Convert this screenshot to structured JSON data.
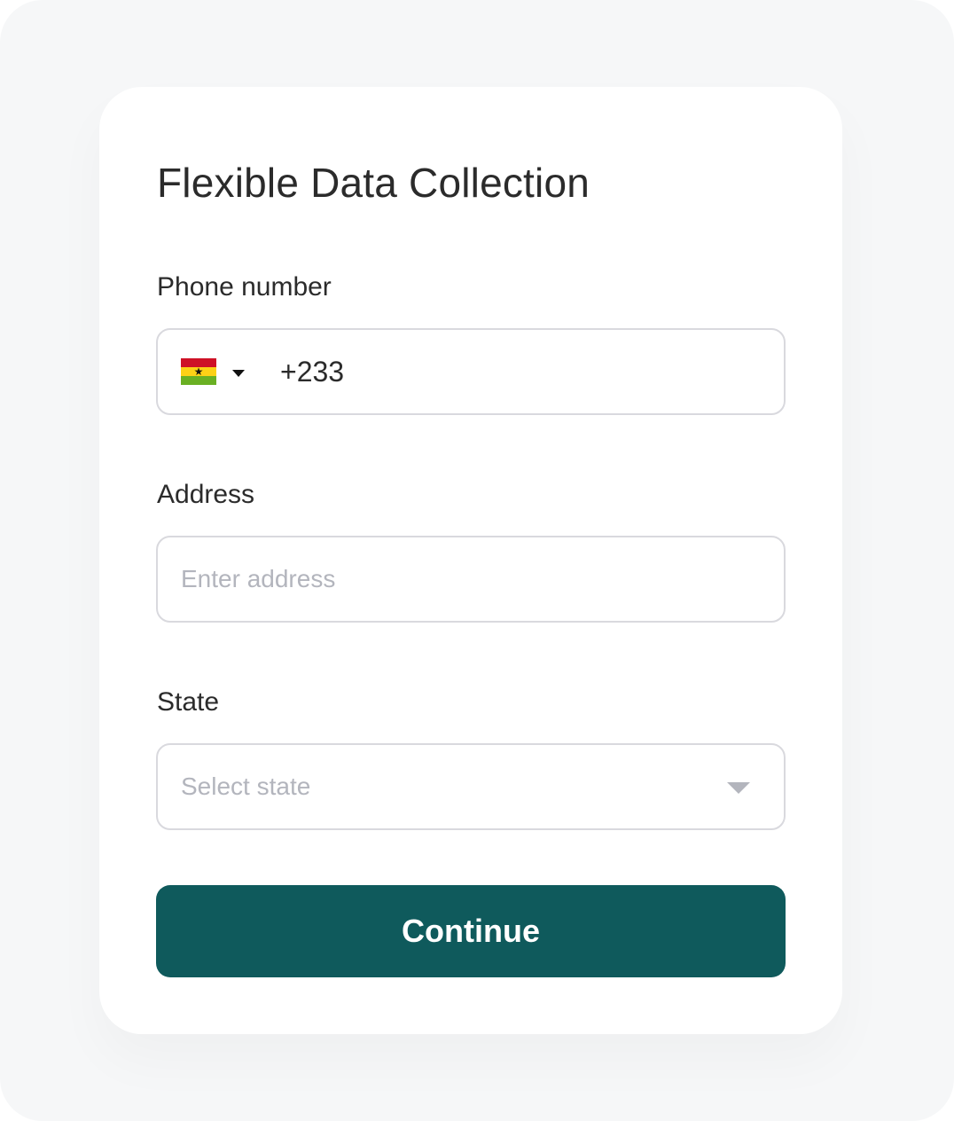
{
  "form": {
    "title": "Flexible Data Collection",
    "phone": {
      "label": "Phone number",
      "country_flag_icon": "ghana-flag-icon",
      "dial_code": "+233"
    },
    "address": {
      "label": "Address",
      "placeholder": "Enter address",
      "value": ""
    },
    "state": {
      "label": "State",
      "placeholder": "Select state"
    },
    "submit_label": "Continue"
  },
  "colors": {
    "accent": "#0f5a5c",
    "text": "#2b2b2b",
    "placeholder": "#b3b5bd",
    "border": "#d9d9de",
    "backdrop": "#f6f7f8",
    "flag_red": "#ce1126",
    "flag_gold": "#fcd116",
    "flag_green": "#6ab023"
  }
}
